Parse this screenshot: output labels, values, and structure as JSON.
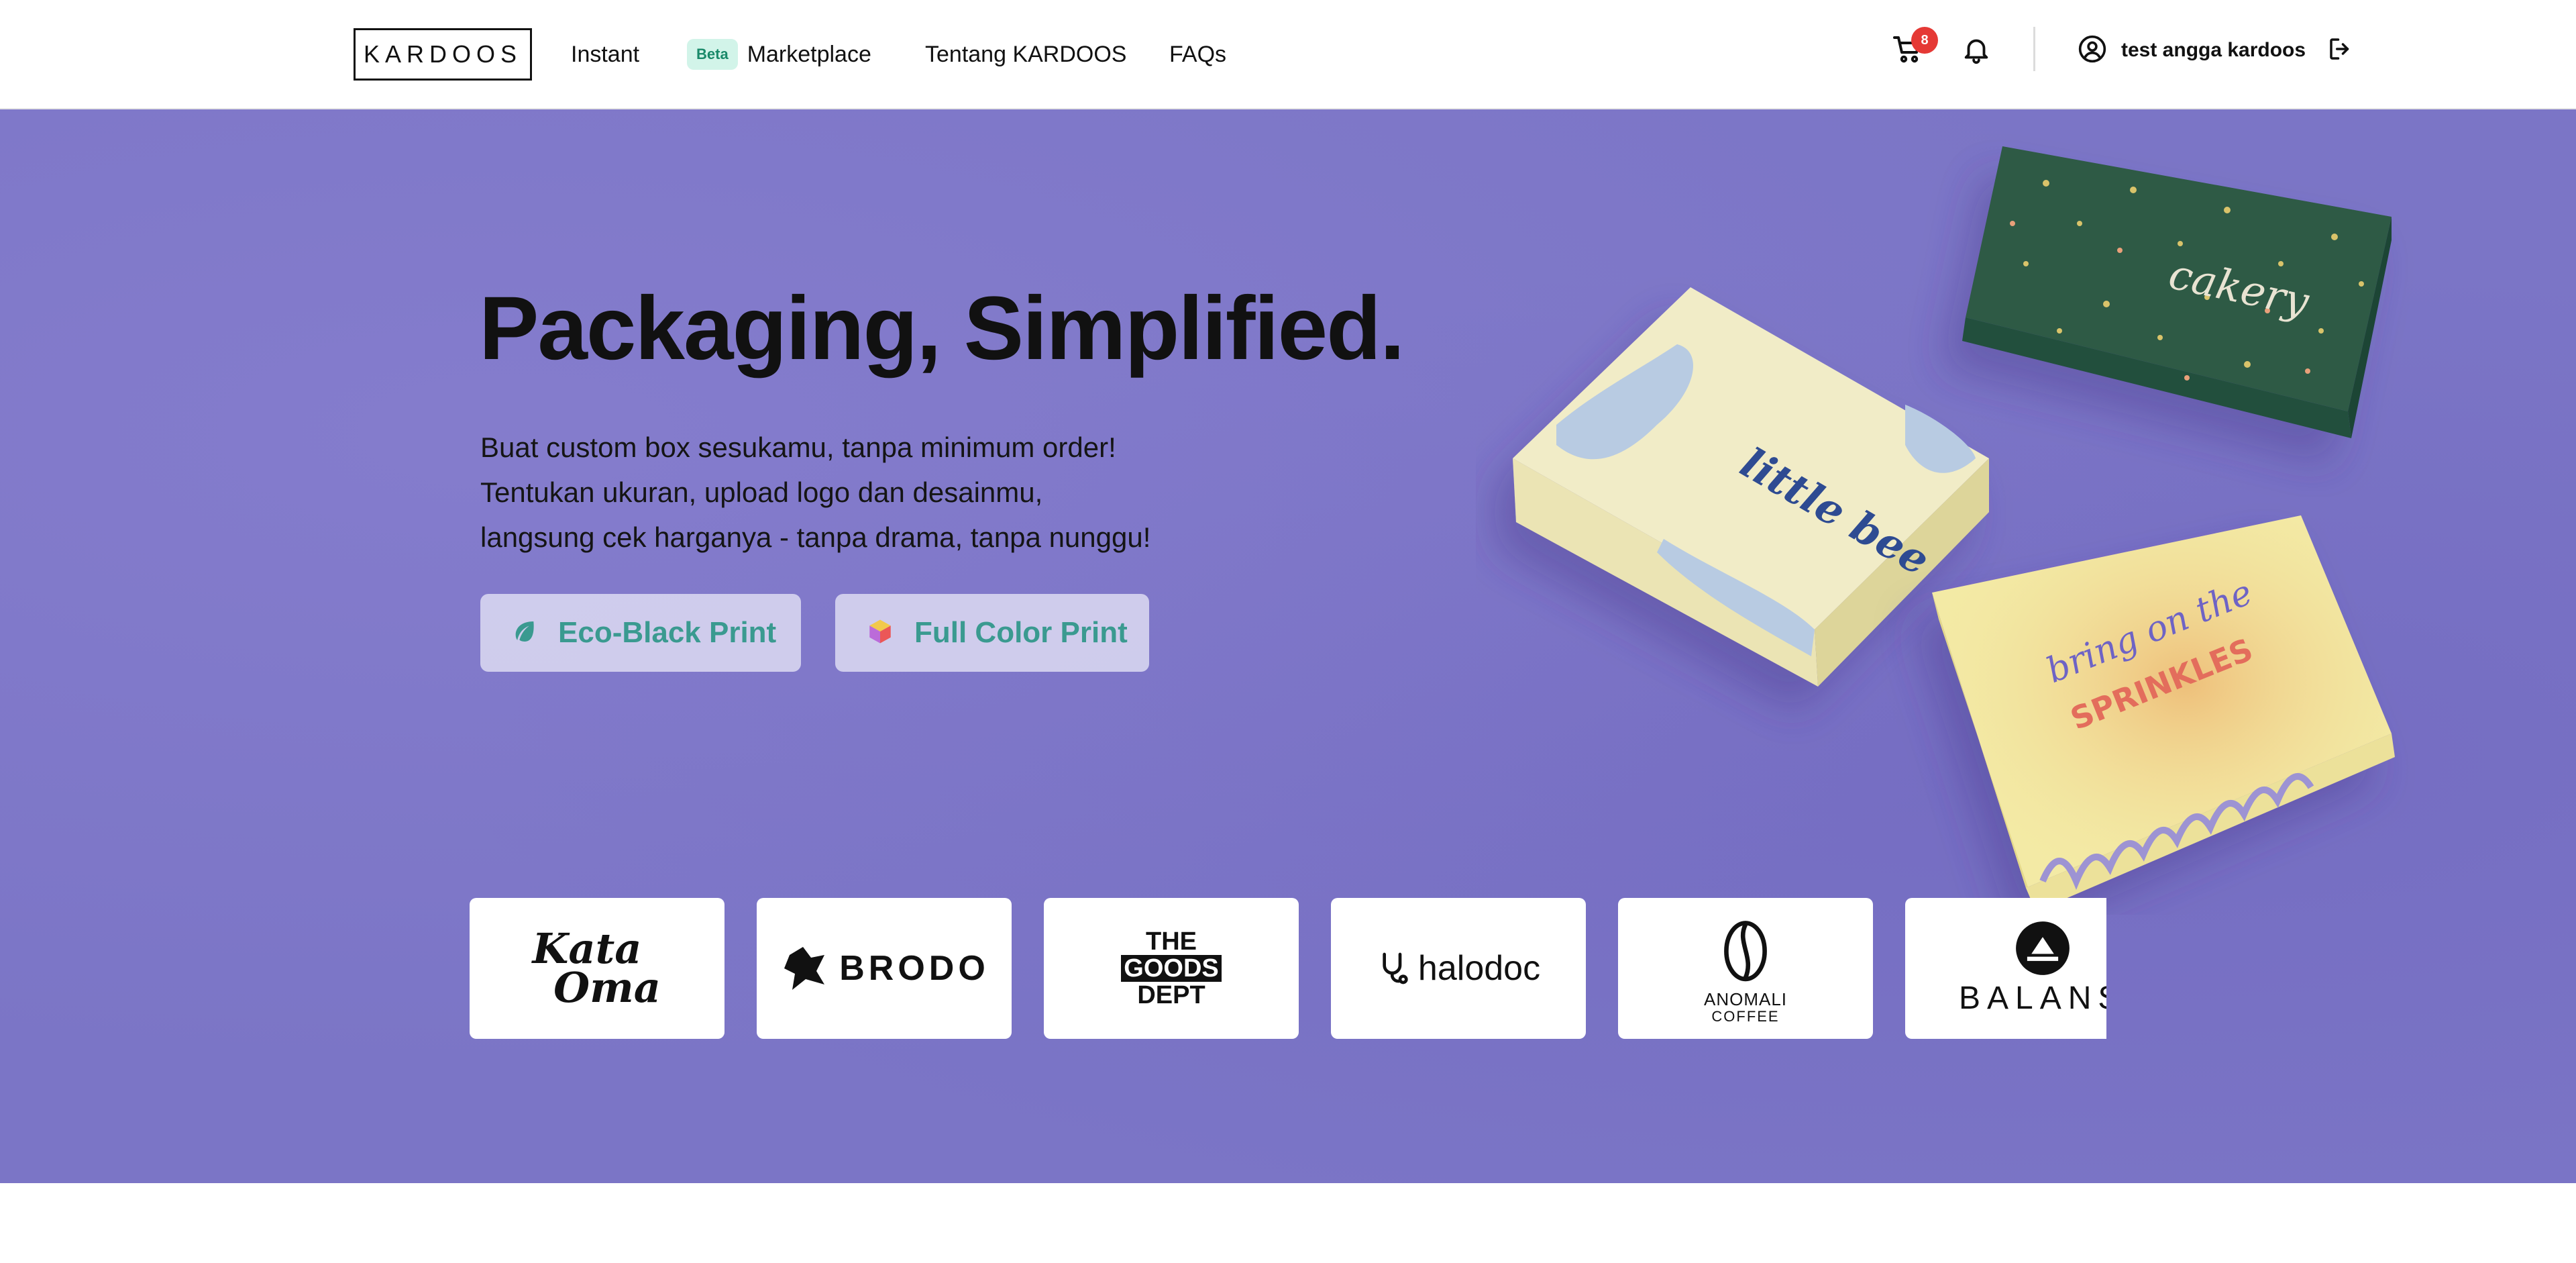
{
  "header": {
    "logo_text": "KARDOOS",
    "nav": [
      {
        "label": "Instant"
      },
      {
        "label": "Marketplace",
        "badge": "Beta"
      },
      {
        "label": "Tentang KARDOOS"
      },
      {
        "label": "FAQs"
      }
    ],
    "cart_count": "8",
    "user_name": "test angga kardoos"
  },
  "hero": {
    "title": "Packaging, Simplified.",
    "description_lines": [
      "Buat custom box sesukamu, tanpa minimum order!",
      "Tentukan ukuran, upload logo dan desainmu,",
      "langsung cek harganya - tanpa drama, tanpa nunggu!"
    ],
    "buttons": [
      {
        "label": "Eco-Black Print",
        "icon": "leaf-icon"
      },
      {
        "label": "Full Color Print",
        "icon": "color-cube-icon"
      }
    ],
    "box_prints": {
      "cakery": "cakery",
      "little_bee": "little bee",
      "sprinkles_line1": "bring on the",
      "sprinkles_line2": "SPRINKLES"
    }
  },
  "brands": [
    {
      "line1": "Kata",
      "line2": "Oma"
    },
    {
      "name": "BRODO"
    },
    {
      "line1": "THE",
      "line2": "GOODS",
      "line3": "DEPT"
    },
    {
      "name": "halodoc"
    },
    {
      "line1": "ANOMALI",
      "line2": "COFFEE"
    },
    {
      "name": "BALANS"
    }
  ],
  "colors": {
    "hero_bg": "#7b75c6",
    "button_text": "#3a9a90",
    "badge_bg": "#d2f4e9",
    "cart_badge": "#e53935"
  }
}
